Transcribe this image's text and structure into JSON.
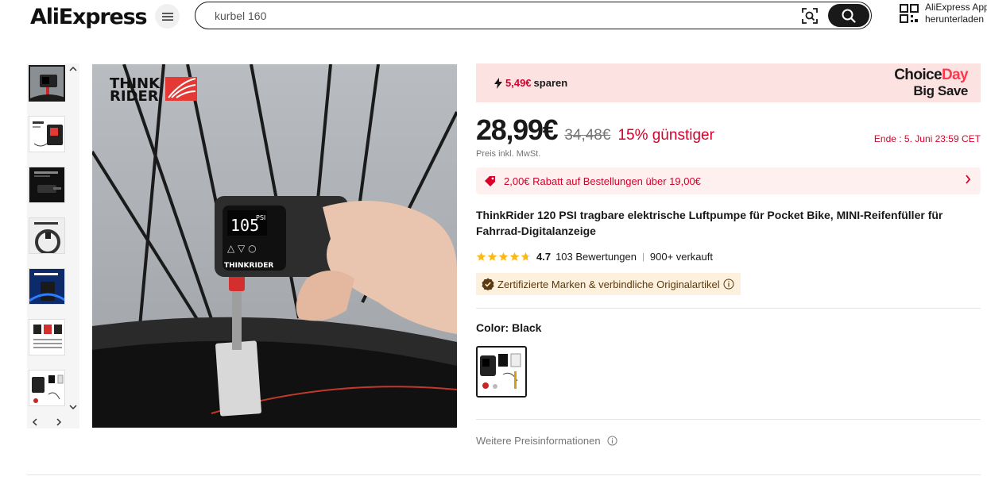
{
  "header": {
    "logo_text": "AliExpress",
    "search": {
      "value": "kurbel 160"
    },
    "app_download": {
      "line1": "AliExpress App",
      "line2": "herunterladen"
    }
  },
  "promo": {
    "save_amount": "5,49€",
    "save_text": "sparen",
    "choice_part1": "Choice",
    "choice_part2": "Day",
    "big_save": "Big Save"
  },
  "price": {
    "current": "28,99€",
    "original": "34,48€",
    "discount": "15% günstiger",
    "tax_note": "Preis inkl. MwSt.",
    "ends": "Ende :  5. Juni 23:59 CET"
  },
  "coupon": {
    "text": "2,00€ Rabatt auf Bestellungen über 19,00€"
  },
  "product": {
    "title": "ThinkRider 120 PSI tragbare elektrische Luftpumpe für Pocket Bike, MINI-Reifenfüller für Fahrrad-Digitalanzeige",
    "rating": "4.7",
    "rating_value": 4.7,
    "reviews": "103 Bewertungen",
    "sold": "900+ verkauft",
    "certified": "Zertifizierte Marken & verbindliche Originalartikel",
    "color_label": "Color:",
    "color_value": "Black",
    "more_info": "Weitere Preisinformationen"
  },
  "images": {
    "brand_line1": "THINK",
    "brand_line2": "RIDER",
    "device_brand": "THINKRIDER",
    "display_psi": "PSI",
    "display_value": "105"
  },
  "colors": {
    "accent_red": "#d7002a",
    "promo_bg": "#fde2e2",
    "coupon_bg": "#fff0f0",
    "cert_bg": "#fdf0dc",
    "star": "#fdb913"
  },
  "icons": {
    "menu": "menu-icon",
    "camera_search": "image-search-icon",
    "search": "search-icon",
    "qr": "qr-code-icon",
    "savings": "lightning-icon",
    "coupon": "tag-icon",
    "chevron": "chevron-right-icon",
    "cert": "verified-badge-icon",
    "info": "info-icon"
  }
}
